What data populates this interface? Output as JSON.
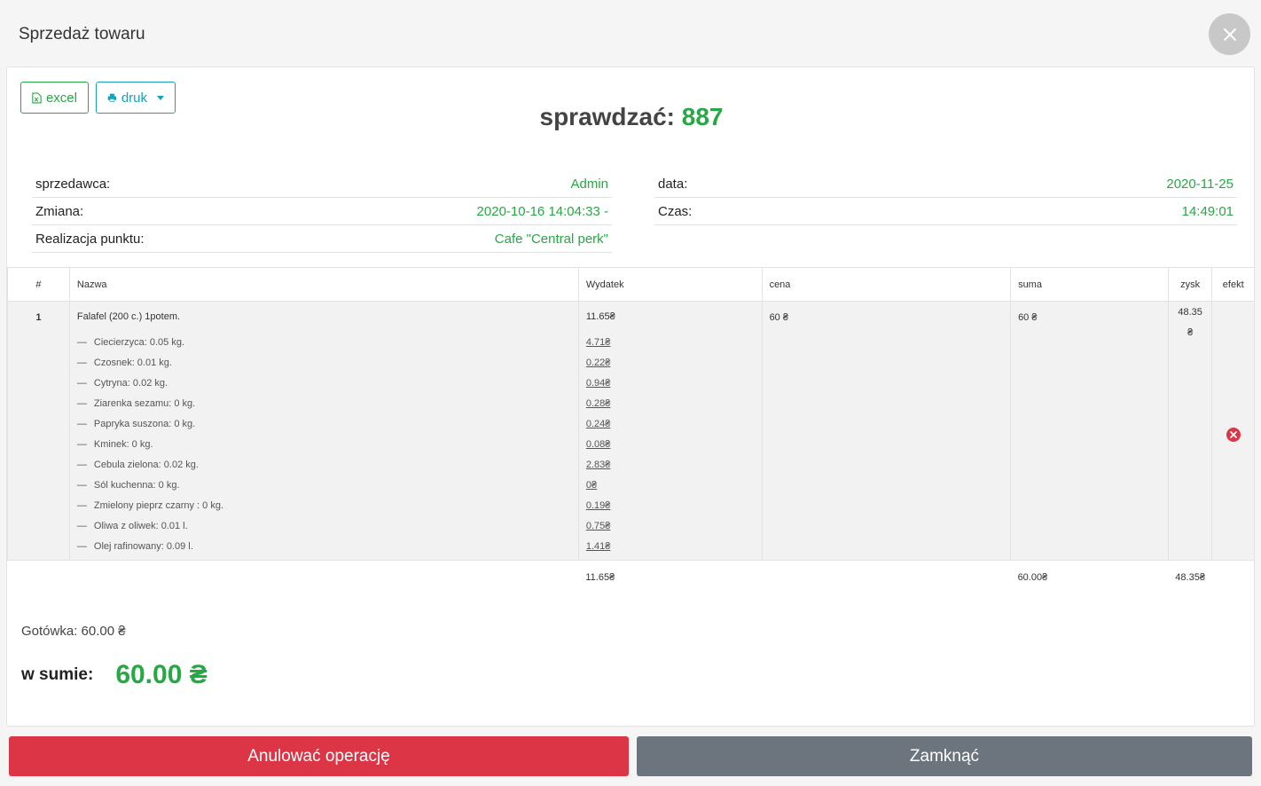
{
  "modal": {
    "title": "Sprzedaż towaru"
  },
  "toolbar": {
    "excel_label": "excel",
    "print_label": "druk"
  },
  "check": {
    "label": "sprawdzać:",
    "number": "887"
  },
  "info_left": [
    {
      "label": "sprzedawca:",
      "value": "Admin"
    },
    {
      "label": "Zmiana:",
      "value": "2020-10-16 14:04:33 -"
    },
    {
      "label": "Realizacja punktu:",
      "value": "Cafe \"Central perk\""
    }
  ],
  "info_right": [
    {
      "label": "data:",
      "value": "2020-11-25"
    },
    {
      "label": "Czas:",
      "value": "14:49:01"
    }
  ],
  "table": {
    "headers": [
      "#",
      "Nazwa",
      "Wydatek",
      "cena",
      "suma",
      "zysk",
      "efekt"
    ],
    "row": {
      "num": "1",
      "name": "Falafel (200 c.) 1potem.",
      "cost": "11.65₴",
      "price": "60 ₴",
      "sum": "60 ₴",
      "profit": "48.35 ₴",
      "ingredients": [
        {
          "dash": "—",
          "name": "Ciecierzyca: 0.05 kg.",
          "cost": "4.71₴"
        },
        {
          "dash": "—",
          "name": "Czosnek: 0.01 kg.",
          "cost": "0.22₴"
        },
        {
          "dash": "—",
          "name": "Cytryna: 0.02 kg.",
          "cost": "0.94₴"
        },
        {
          "dash": "—",
          "name": "Ziarenka sezamu: 0 kg.",
          "cost": "0.28₴"
        },
        {
          "dash": "—",
          "name": "Papryka suszona: 0 kg.",
          "cost": "0.24₴"
        },
        {
          "dash": "—",
          "name": "Kminek: 0 kg.",
          "cost": "0.08₴"
        },
        {
          "dash": "—",
          "name": "Cebula zielona: 0.02 kg.",
          "cost": "2.83₴"
        },
        {
          "dash": "—",
          "name": "Sól kuchenna: 0 kg.",
          "cost": "0₴"
        },
        {
          "dash": "—",
          "name": "Zmielony pieprz czarny : 0 kg.",
          "cost": "0.19₴"
        },
        {
          "dash": "—",
          "name": "Oliwa z oliwek: 0.01 l.",
          "cost": "0.75₴"
        },
        {
          "dash": "—",
          "name": "Olej rafinowany: 0.09 l.",
          "cost": "1.41₴"
        }
      ]
    },
    "totals": {
      "cost": "11.65₴",
      "sum": "60.00₴",
      "profit": "48.35₴"
    }
  },
  "payment": {
    "cash": "Gotówka: 60.00 ₴"
  },
  "total": {
    "label": "w sumie:",
    "value": "60.00 ₴"
  },
  "footer": {
    "cancel_label": "Anulować operację",
    "close_label": "Zamknąć"
  },
  "colors": {
    "green": "#28a745",
    "teal": "#17a2b8",
    "red": "#dc3545",
    "gray": "#6c757d"
  }
}
